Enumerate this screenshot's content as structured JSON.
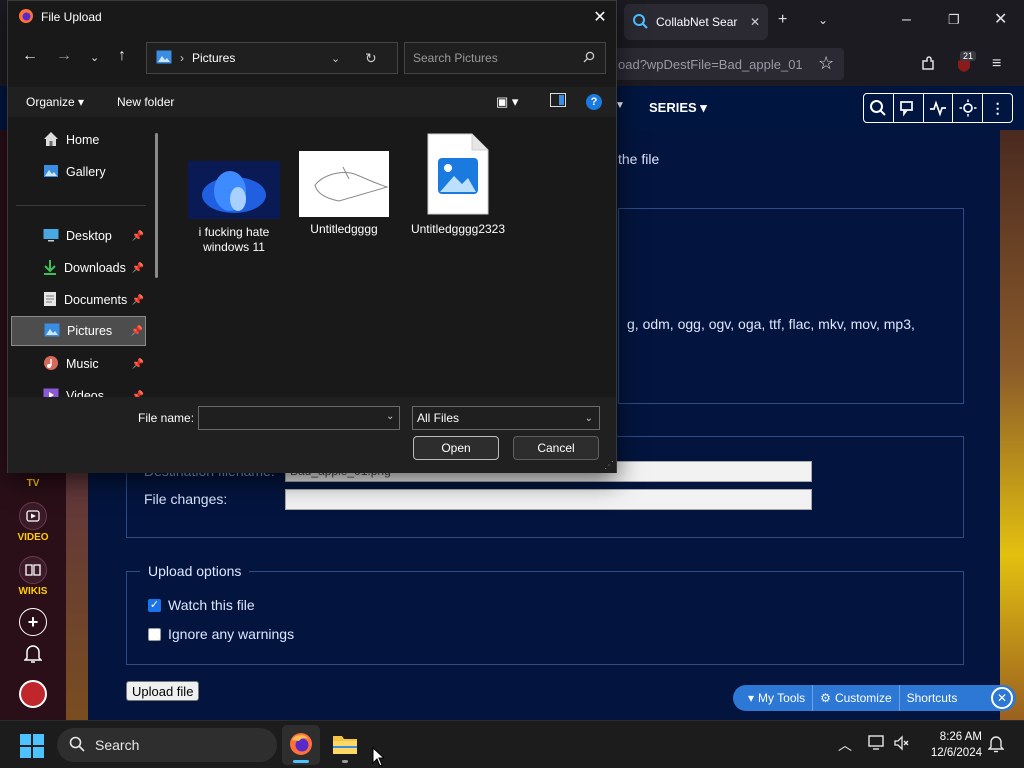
{
  "browser": {
    "tab_label": "CollabNet Sear",
    "url_text": "oad?wpDestFile=Bad_apple_01",
    "extension_badge": "21"
  },
  "wiki": {
    "nav_series": "SERIES",
    "intro_text": "the file",
    "file_types": "g, odm, ogg, ogv, oga, ttf, flac, mkv, mov, mp3,",
    "dest_label": "Destination filename:",
    "dest_value": "Bad_apple_01.png",
    "changes_label": "File changes:",
    "options_legend": "Upload options",
    "watch_label": "Watch this file",
    "ignore_label": "Ignore any warnings",
    "upload_button": "Upload file",
    "rail": {
      "tv": "TV",
      "video": "VIDEO",
      "wikis": "WIKIS"
    },
    "toolbar": {
      "my_tools": "My Tools",
      "customize": "Customize",
      "shortcuts": "Shortcuts"
    }
  },
  "dialog": {
    "title": "File Upload",
    "address": "Pictures",
    "search_placeholder": "Search Pictures",
    "organize": "Organize",
    "new_folder": "New folder",
    "nav_items": [
      {
        "label": "Home"
      },
      {
        "label": "Gallery"
      },
      {
        "label": "Desktop"
      },
      {
        "label": "Downloads"
      },
      {
        "label": "Documents"
      },
      {
        "label": "Pictures"
      },
      {
        "label": "Music"
      },
      {
        "label": "Videos"
      }
    ],
    "files": [
      {
        "name": "i fucking hate windows 11"
      },
      {
        "name": "Untitledgggg"
      },
      {
        "name": "Untitledgggg2323"
      }
    ],
    "file_name_label": "File name:",
    "file_name_value": "",
    "filter": "All Files",
    "open_button": "Open",
    "cancel_button": "Cancel"
  },
  "taskbar": {
    "search_label": "Search",
    "time": "8:26 AM",
    "date": "12/6/2024"
  },
  "colors": {
    "accent": "#4cc2ff",
    "wiki_bg": "#03153f",
    "toolbar_blue": "#2c78d4",
    "rail_text": "#ffcc00"
  }
}
